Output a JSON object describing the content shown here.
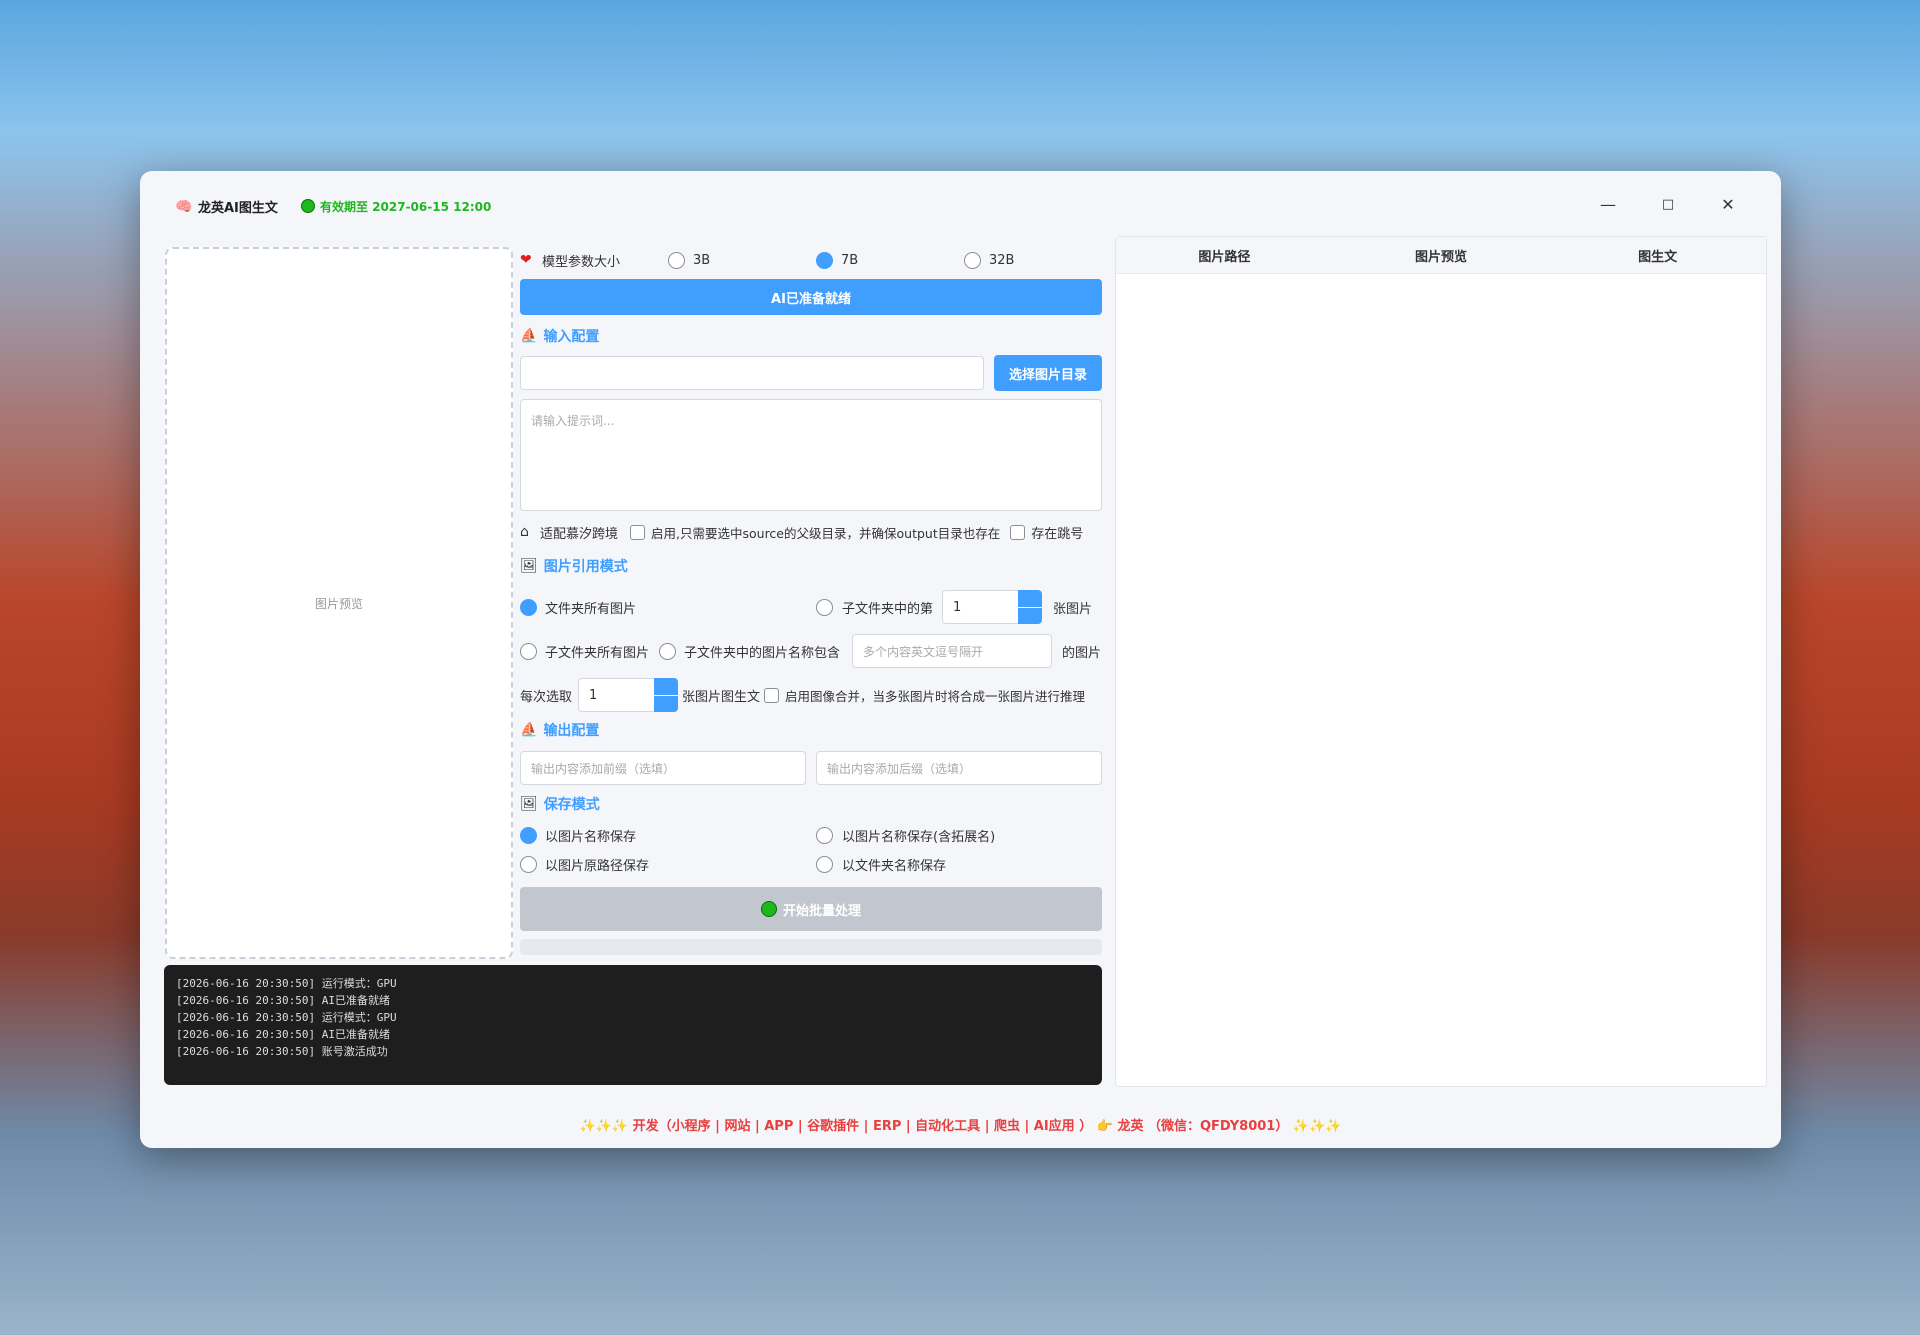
{
  "app": {
    "title": "龙英AI图生文",
    "status_text": "有效期至 2027-06-15 12:00"
  },
  "window_controls": {
    "minimize": "—",
    "maximize": "□",
    "close": "✕"
  },
  "preview": {
    "placeholder": "图片预览"
  },
  "model": {
    "label": "模型参数大小",
    "options": [
      {
        "label": "3B",
        "selected": false
      },
      {
        "label": "7B",
        "selected": true
      },
      {
        "label": "32B",
        "selected": false
      }
    ]
  },
  "ready_button": "AI已准备就绪",
  "input_config": {
    "title": "输入配置",
    "dir_value": "",
    "select_dir_button": "选择图片目录",
    "prompt_placeholder": "请输入提示词..."
  },
  "cross": {
    "label": "适配慕汐跨境",
    "enable_label": "启用,只需要选中source的父级目录，并确保output目录也存在",
    "skip_label": "存在跳号"
  },
  "image_mode": {
    "title": "图片引用模式",
    "all_in_folder": "文件夹所有图片",
    "nth_in_sub": "子文件夹中的第",
    "nth_value": "1",
    "nth_suffix": "张图片",
    "all_in_sub": "子文件夹所有图片",
    "name_contains": "子文件夹中的图片名称包含",
    "name_placeholder": "多个内容英文逗号隔开",
    "name_suffix": "的图片",
    "each_pick": "每次选取",
    "each_value": "1",
    "each_suffix": "张图片图生文",
    "merge_label": "启用图像合并，当多张图片时将合成一张图片进行推理"
  },
  "output_config": {
    "title": "输出配置",
    "prefix_placeholder": "输出内容添加前缀（选填）",
    "suffix_placeholder": "输出内容添加后缀（选填）"
  },
  "save_mode": {
    "title": "保存模式",
    "by_name": "以图片名称保存",
    "by_name_ext": "以图片名称保存(含拓展名)",
    "by_path": "以图片原路径保存",
    "by_folder": "以文件夹名称保存"
  },
  "start_button": "开始批量处理",
  "logs": [
    "[2026-06-16 20:30:50] 运行模式：GPU",
    "[2026-06-16 20:30:50] AI已准备就绪",
    "[2026-06-16 20:30:50] 运行模式：GPU",
    "[2026-06-16 20:30:50] AI已准备就绪",
    "[2026-06-16 20:30:50] 账号激活成功"
  ],
  "table": {
    "columns": [
      "图片路径",
      "图片预览",
      "图生文"
    ]
  },
  "footer": {
    "text": "开发（小程序 | 网站 | APP | 谷歌插件 | ERP | 自动化工具 | 爬虫 | AI应用 ）",
    "author": "龙英 （微信：QFDY8001）"
  },
  "colors": {
    "accent": "#409eff",
    "status_green": "#1eb81e",
    "footer_red": "#e83f3f"
  }
}
